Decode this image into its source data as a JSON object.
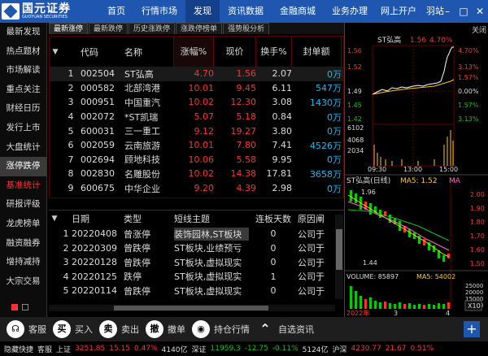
{
  "brand": {
    "name_cn": "国元证券",
    "name_en": "GUOYUAN SECURITIES"
  },
  "nav": {
    "items": [
      "首页",
      "行情市场",
      "发现",
      "资讯数据",
      "金融商城",
      "业务办理",
      "网上开户"
    ],
    "active": "发现",
    "user": "羽站"
  },
  "sidebar": {
    "items": [
      "最新发现",
      "热点题材",
      "市场解读",
      "重点关注",
      "财经日历",
      "发行上市",
      "大盘统计",
      "涨停跌停",
      "基准统计",
      "研报评级",
      "龙虎榜单",
      "融资融券",
      "增持减持",
      "大宗交易"
    ],
    "active": "涨停跌停",
    "red": "基准统计"
  },
  "tabs": {
    "items": [
      "最新涨停",
      "最新跌停",
      "历史涨跌停",
      "涨跌停榜单",
      "强势股分析"
    ],
    "active": "最新涨停",
    "close": "关闭"
  },
  "table": {
    "headers": {
      "code": "代码",
      "name": "名称",
      "pct": "涨幅%",
      "price": "现价",
      "turnover": "换手%",
      "seal": "封单额"
    },
    "rows": [
      {
        "idx": "1",
        "code": "002504",
        "name": "ST弘高",
        "pct": "4.70",
        "price": "1.56",
        "turnover": "2.07",
        "seal": "0万"
      },
      {
        "idx": "2",
        "code": "000582",
        "name": "北部湾港",
        "pct": "10.01",
        "price": "9.45",
        "turnover": "6.11",
        "seal": "547万"
      },
      {
        "idx": "3",
        "code": "000951",
        "name": "中国重汽",
        "pct": "10.02",
        "price": "12.30",
        "turnover": "3.08",
        "seal": "1430万"
      },
      {
        "idx": "4",
        "code": "002072",
        "name": "*ST凯瑞",
        "pct": "5.07",
        "price": "5.18",
        "turnover": "0.84",
        "seal": "0万"
      },
      {
        "idx": "5",
        "code": "600031",
        "name": "三一重工",
        "pct": "9.12",
        "price": "19.27",
        "turnover": "3.80",
        "seal": "0万"
      },
      {
        "idx": "6",
        "code": "002059",
        "name": "云南旅游",
        "pct": "10.01",
        "price": "7.80",
        "turnover": "7.41",
        "seal": "4526万"
      },
      {
        "idx": "7",
        "code": "002694",
        "name": "顾地科技",
        "pct": "10.06",
        "price": "5.58",
        "turnover": "9.95",
        "seal": "0万"
      },
      {
        "idx": "8",
        "code": "002830",
        "name": "名雕股份",
        "pct": "10.02",
        "price": "14.38",
        "turnover": "17.81",
        "seal": "3658万"
      },
      {
        "idx": "9",
        "code": "600675",
        "name": "中华企业",
        "pct": "9.20",
        "price": "4.39",
        "turnover": "2.98",
        "seal": "0万"
      }
    ]
  },
  "history": {
    "headers": {
      "date": "日期",
      "type": "类型",
      "theme": "短线主题",
      "days": "连板天数",
      "reason": "原因阐"
    },
    "rows": [
      {
        "idx": "1",
        "date": "20220408",
        "type": "曾涨停",
        "theme": "装饰园林,ST板块",
        "days": "0",
        "reason": "公司于"
      },
      {
        "idx": "2",
        "date": "20220309",
        "type": "曾跌停",
        "theme": "ST板块,业绩预亏",
        "days": "0",
        "reason": "公司于"
      },
      {
        "idx": "3",
        "date": "20220128",
        "type": "曾跌停",
        "theme": "ST板块,虚拟现实",
        "days": "0",
        "reason": "公司于"
      },
      {
        "idx": "4",
        "date": "20220125",
        "type": "跌停",
        "theme": "ST板块,虚拟现实",
        "days": "1",
        "reason": "公司于"
      },
      {
        "idx": "5",
        "date": "20220114",
        "type": "曾跌停",
        "theme": "ST板块,虚拟现实",
        "days": "0",
        "reason": "公司于"
      }
    ]
  },
  "intraday": {
    "title": "ST弘高",
    "price": "1.56",
    "pct": "4.70%",
    "left_axis": [
      "1.56",
      "1.52",
      "1.49",
      "1.45",
      "1.42"
    ],
    "right_axis": [
      "4.70%",
      "3.13%",
      "1.57%",
      "0.00%",
      "1.57%",
      "3.13%"
    ],
    "vol_axis": [
      "6102",
      "4068",
      "2034"
    ],
    "times": [
      "09:30",
      "13:00",
      "15:00"
    ]
  },
  "kline": {
    "title": "ST弘高(日线)",
    "ma5": "MA5: 1.52",
    "ma_other": "MA",
    "high": "1.96",
    "low": "1.44",
    "right_axis": [
      "2.00",
      "1.90",
      "1.80",
      "1.70",
      "1.60",
      "1.50"
    ],
    "volume": "VOLUME: 85897",
    "vol_ma5": "MA5: 54002",
    "vol_axis": [
      "25000",
      "20000",
      "15000",
      "10000",
      "5000"
    ],
    "vol_unit": "X10",
    "dates": [
      "2022年",
      "3",
      "4"
    ]
  },
  "toolbar": {
    "items": [
      {
        "icon": "headset",
        "label": "客服"
      },
      {
        "icon": "buy",
        "label": "买入",
        "glyph": "买"
      },
      {
        "icon": "sell",
        "label": "卖出",
        "glyph": "卖"
      },
      {
        "icon": "cancel",
        "label": "撤单",
        "glyph": "撤"
      },
      {
        "icon": "position",
        "label": "持仓行情"
      },
      {
        "icon": "news",
        "label": "自选资讯"
      }
    ]
  },
  "status": {
    "items": [
      {
        "label": "隐藏快捷",
        "color": "#ddd"
      },
      {
        "label": "客服",
        "color": "#ddd"
      },
      {
        "label": "上证",
        "color": "#ddd"
      },
      {
        "label": "3251.85",
        "color": "#ff3030"
      },
      {
        "label": "15.15",
        "color": "#ff3030"
      },
      {
        "label": "0.47%",
        "color": "#ff3030"
      },
      {
        "label": "4140亿",
        "color": "#ddd"
      },
      {
        "label": "深证",
        "color": "#ddd"
      },
      {
        "label": "11959.3",
        "color": "#00cc00"
      },
      {
        "label": "-12.75",
        "color": "#00cc00"
      },
      {
        "label": "-0.11%",
        "color": "#00cc00"
      },
      {
        "label": "5124亿",
        "color": "#ddd"
      },
      {
        "label": "沪深",
        "color": "#ddd"
      },
      {
        "label": "4230.77",
        "color": "#ff3030"
      },
      {
        "label": "21.67",
        "color": "#ff3030"
      },
      {
        "label": "0.51%",
        "color": "#ff3030"
      }
    ]
  },
  "colors": {
    "accent": "#1e56b0",
    "up": "#ff3030",
    "down": "#00cc00",
    "seal": "#00c0ff"
  }
}
